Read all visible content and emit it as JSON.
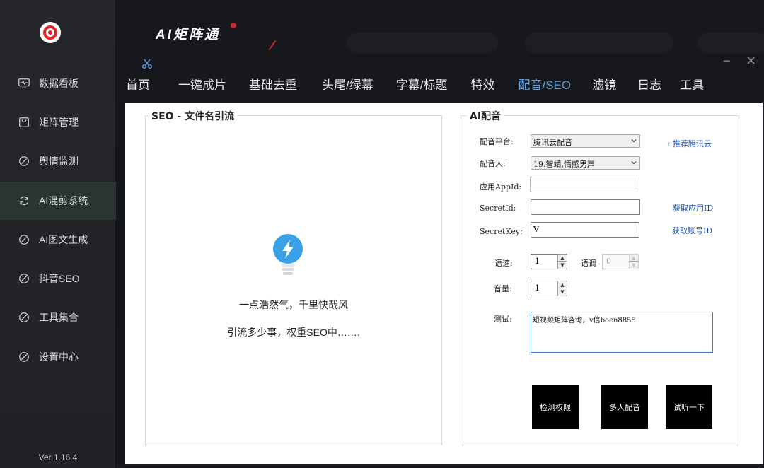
{
  "app": {
    "brand": "AI矩阵通",
    "version": "Ver 1.16.4"
  },
  "sidebar": {
    "items": [
      {
        "label": "数据看板",
        "icon": "monitor-pulse-icon"
      },
      {
        "label": "矩阵管理",
        "icon": "bag-icon"
      },
      {
        "label": "舆情监测",
        "icon": "slash-circle-icon"
      },
      {
        "label": "AI混剪系统",
        "icon": "refresh-icon"
      },
      {
        "label": "AI图文生成",
        "icon": "slash-circle-icon"
      },
      {
        "label": "抖音SEO",
        "icon": "slash-circle-icon"
      },
      {
        "label": "工具集合",
        "icon": "slash-circle-icon"
      },
      {
        "label": "设置中心",
        "icon": "slash-circle-icon"
      }
    ],
    "active_index": 3
  },
  "nav": {
    "tabs": [
      "首页",
      "一键成片",
      "基础去重",
      "头尾/绿幕",
      "字幕/标题",
      "特效",
      "配音/SEO",
      "滤镜",
      "日志",
      "工具"
    ],
    "active_index": 6
  },
  "window_controls": {
    "minimize": "−",
    "close": "✕"
  },
  "seo_panel": {
    "title": "SEO -  文件名引流",
    "line1": "一点浩然气，千里快哉风",
    "line2": "引流多少事，权重SEO中……."
  },
  "voice_panel": {
    "title": "AI配音",
    "platform_label": "配音平台:",
    "platform_value": "腾讯云配音",
    "recommend_link": "推荐腾讯云",
    "speaker_label": "配音人:",
    "speaker_value": "19.智靖,情感男声",
    "appid_label": "应用AppId:",
    "appid_value": "",
    "secretid_label": "SecretId:",
    "secretid_value": "",
    "get_app_id_link": "获取应用ID",
    "secretkey_label": "SecretKey:",
    "secretkey_value": "V",
    "get_account_id_link": "获取账号ID",
    "speed_label": "语速:",
    "speed_value": "1",
    "pitch_label": "语调",
    "pitch_value": "0",
    "volume_label": "音量:",
    "volume_value": "1",
    "test_label": "测试:",
    "test_value": "短视频矩阵咨询，v信boen8855",
    "btn_check": "检测权限",
    "btn_multi": "多人配音",
    "btn_listen": "试听一下"
  },
  "colors": {
    "accent": "#5ba3e6",
    "brand_red": "#e0242a",
    "sidebar_bg": "#23252a",
    "active_item_bg": "#2b3532"
  }
}
